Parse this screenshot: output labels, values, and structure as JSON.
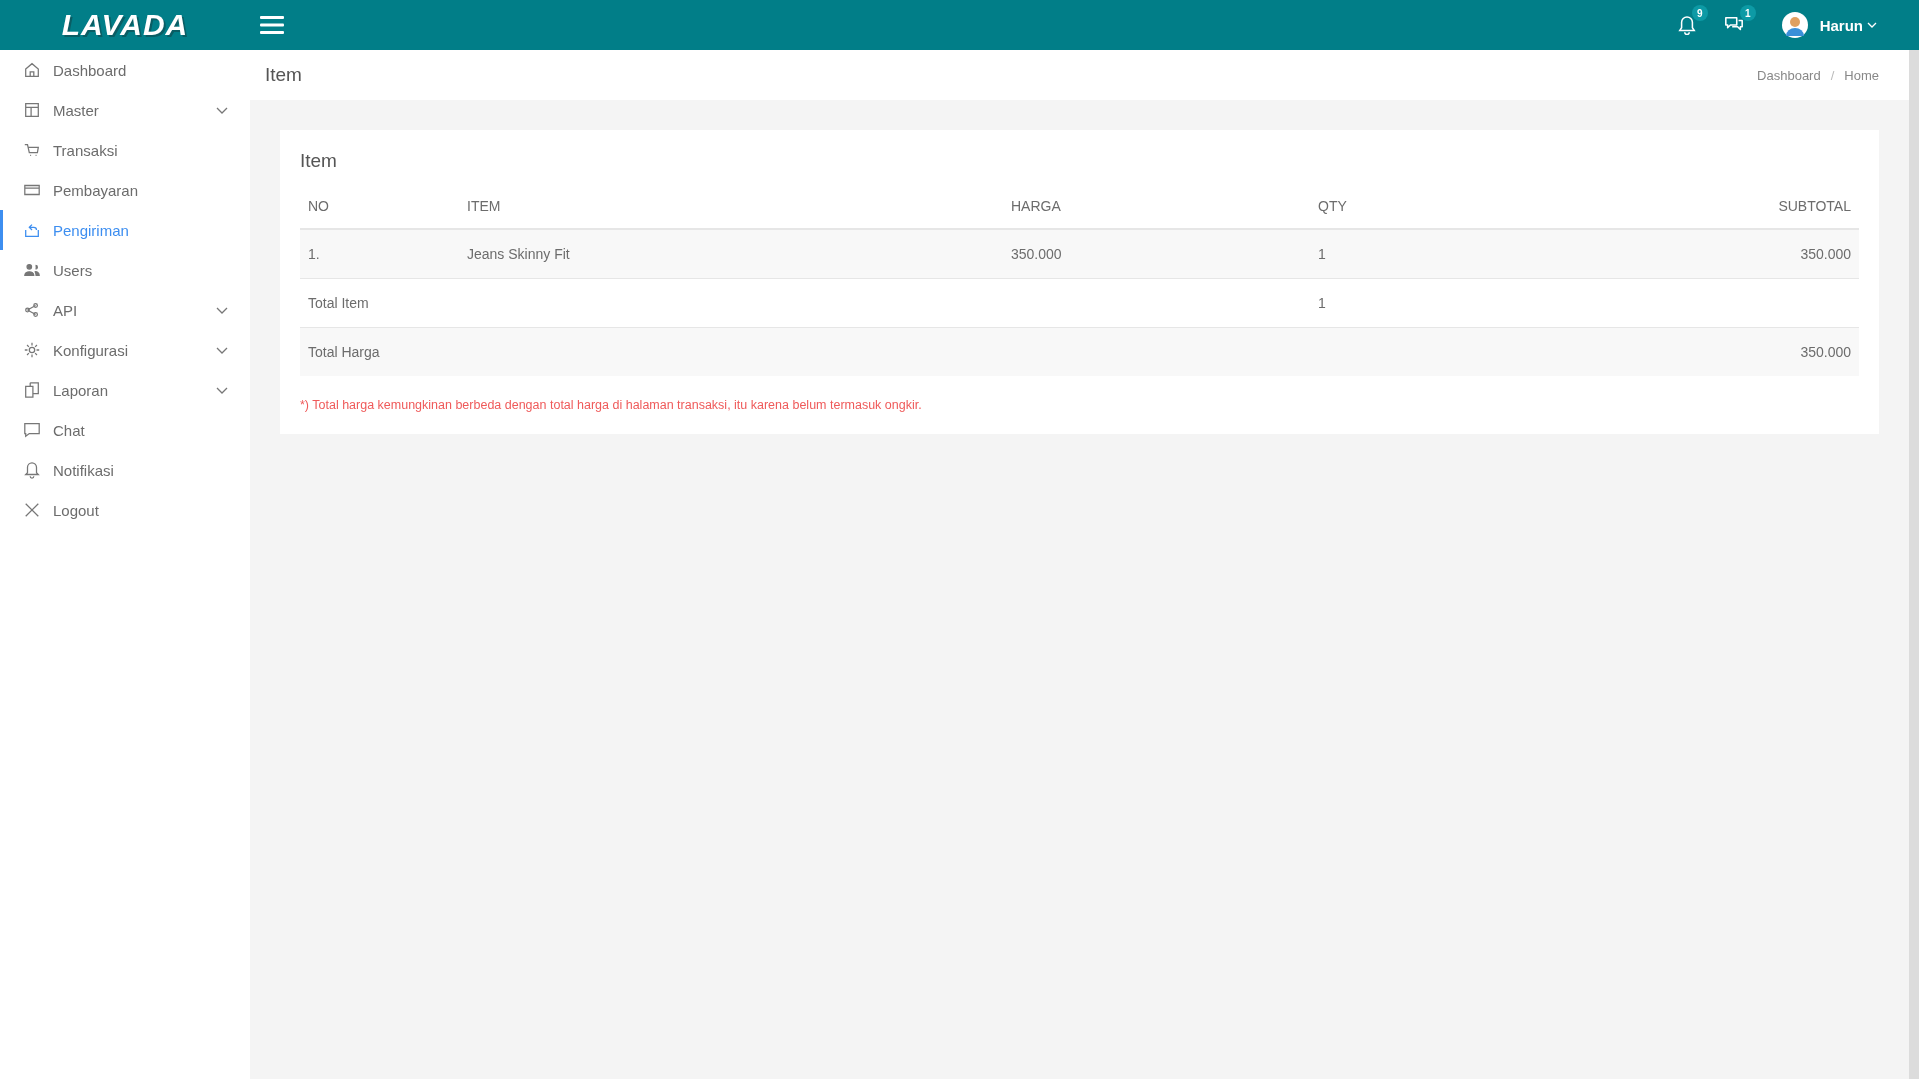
{
  "topbar": {
    "logo": "LAVADA",
    "notifications": {
      "count": "9"
    },
    "messages": {
      "count": "1"
    },
    "user": {
      "name": "Harun"
    }
  },
  "sidebar": {
    "items": [
      {
        "label": "Dashboard",
        "selected": false,
        "expandable": false
      },
      {
        "label": "Master",
        "selected": false,
        "expandable": true
      },
      {
        "label": "Transaksi",
        "selected": false,
        "expandable": false
      },
      {
        "label": "Pembayaran",
        "selected": false,
        "expandable": false
      },
      {
        "label": "Pengiriman",
        "selected": true,
        "expandable": false
      },
      {
        "label": "Users",
        "selected": false,
        "expandable": false
      },
      {
        "label": "API",
        "selected": false,
        "expandable": true
      },
      {
        "label": "Konfigurasi",
        "selected": false,
        "expandable": true
      },
      {
        "label": "Laporan",
        "selected": false,
        "expandable": true
      },
      {
        "label": "Chat",
        "selected": false,
        "expandable": false
      },
      {
        "label": "Notifikasi",
        "selected": false,
        "expandable": false
      },
      {
        "label": "Logout",
        "selected": false,
        "expandable": false
      }
    ]
  },
  "page": {
    "title": "Item",
    "breadcrumb": [
      "Dashboard",
      "Home"
    ],
    "breadcrumb_separator": "/"
  },
  "card": {
    "title": "Item",
    "table": {
      "columns": [
        "NO",
        "ITEM",
        "HARGA",
        "QTY",
        "SUBTOTAL"
      ],
      "rows": [
        {
          "no": "1.",
          "item": "Jeans Skinny Fit",
          "harga": "350.000",
          "qty": "1",
          "subtotal": "350.000"
        }
      ],
      "totals": [
        {
          "label": "Total Item",
          "qty": "1"
        },
        {
          "label": "Total Harga",
          "subtotal": "350.000"
        }
      ]
    },
    "note": "*) Total harga kemungkinan berbeda dengan total harga di halaman transaksi, itu karena belum termasuk ongkir."
  }
}
